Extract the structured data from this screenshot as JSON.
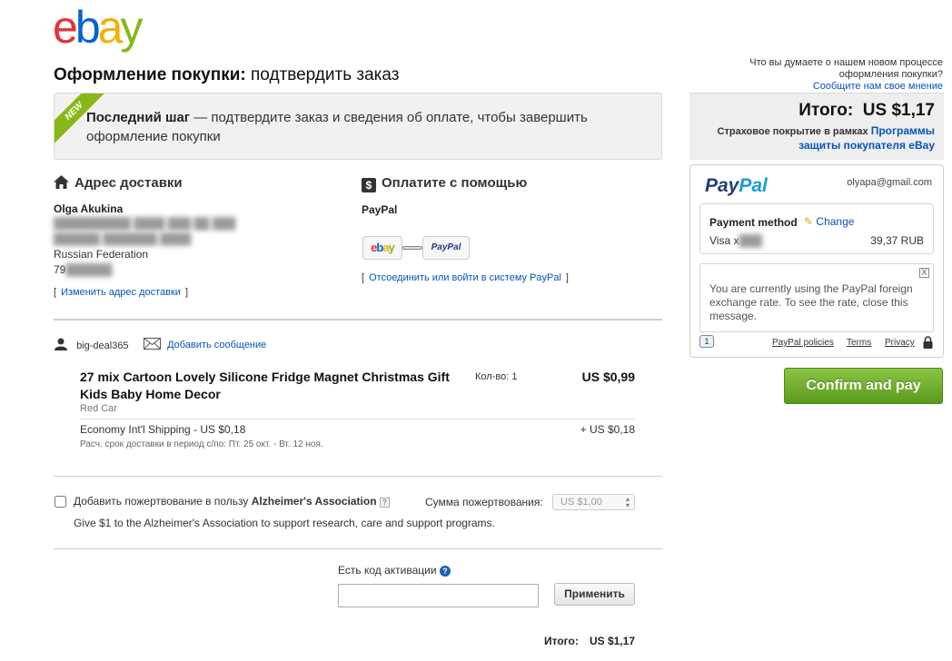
{
  "logo": {
    "e": "e",
    "b": "b",
    "a": "a",
    "y": "y"
  },
  "header": {
    "title_bold": "Оформление покупки:",
    "title_rest": "подтвердить заказ"
  },
  "banner": {
    "ribbon": "NEW",
    "strong": "Последний шаг",
    "text": " — подтвердите заказ и сведения об оплате, чтобы завершить оформление покупки"
  },
  "shipping": {
    "heading": "Адрес доставки",
    "name": "Olga Akukina",
    "line1_hidden": "██████████ ████ ███ ██ ███",
    "line2_hidden": "██████ ███████ ████",
    "country": "Russian Federation",
    "phone_prefix": "79",
    "change_link": "Изменить адрес доставки"
  },
  "payment": {
    "heading": "Оплатите с помощью",
    "method": "PayPal",
    "badge_ebay": "ebay",
    "badge_paypal": "PayPal",
    "link": "Отсоединить или войти в систему PayPal"
  },
  "seller": {
    "name": "big-deal365",
    "message_link": "Добавить сообщение"
  },
  "item": {
    "title": "27 mix Cartoon Lovely Silicone Fridge Magnet Christmas Gift Kids Baby Home Decor",
    "variant": "Red Car",
    "qty": "Кол-во: 1",
    "price": "US $0,99",
    "shipping_label": "Economy Int'l Shipping - US $0,18",
    "shipping_price": "+ US $0,18",
    "delivery": "Расч. срок доставки в период с/по: Пт. 25 окт. - Вт. 12 ноя."
  },
  "donation": {
    "label_prefix": "Добавить пожертвование в пользу",
    "org": "Alzheimer's Association",
    "help": "?",
    "amount_label": "Сумма пожертвования:",
    "amount_value": "US $1,00",
    "description": "Give $1 to the Alzheimer's Association to support research, care and support programs."
  },
  "coupon": {
    "label": "Есть код активации",
    "help": "?",
    "input_value": "",
    "apply": "Применить"
  },
  "bottom_total": {
    "label": "Итого:",
    "value": "US $1,17"
  },
  "sidebar": {
    "feedback_text": "Что вы думаете о нашем новом процессе оформления покупки?",
    "feedback_link": "Сообщите нам свое мнение",
    "total_label": "Итого:",
    "total_value": "US $1,17",
    "insurance_text": "Страховое покрытие в рамках",
    "insurance_link": "Программы защиты покупателя eBay"
  },
  "paypal_panel": {
    "logo_a": "Pay",
    "logo_b": "Pal",
    "email": "olyapa@gmail.com",
    "payment_method_label": "Payment method",
    "change": "Change",
    "visa": "Visa x",
    "amount": "39,37 RUB",
    "fx_message": "You are currently using the PayPal foreign exchange rate. To see the rate, close this message.",
    "fx_close": "X",
    "footer_num": "1",
    "policies": "PayPal policies",
    "terms": "Terms",
    "privacy": "Privacy"
  },
  "confirm": {
    "label": "Confirm and pay"
  },
  "colors": {
    "accent_link": "#0654ba",
    "confirm_green": "#6aac2a",
    "ribbon_green": "#86b817"
  }
}
